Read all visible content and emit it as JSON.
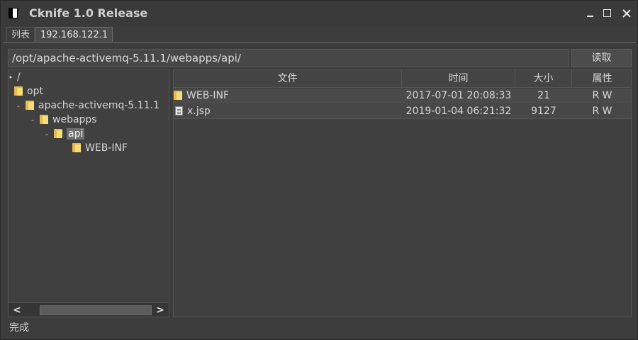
{
  "window": {
    "title": "Cknife 1.0 Release"
  },
  "tabs": [
    {
      "label": "列表"
    },
    {
      "label": "192.168.122.1"
    }
  ],
  "pathbar": {
    "value": "/opt/apache-activemq-5.11.1/webapps/api/",
    "read_label": "读取"
  },
  "tree": {
    "root": "/",
    "nodes": [
      {
        "label": "opt",
        "toggle": ""
      },
      {
        "label": "apache-activemq-5.11.1",
        "toggle": "-"
      },
      {
        "label": "webapps",
        "toggle": "-"
      },
      {
        "label": "api",
        "toggle": "-",
        "selected": true
      },
      {
        "label": "WEB-INF",
        "toggle": ""
      }
    ]
  },
  "table": {
    "headers": [
      "文件",
      "时间",
      "大小",
      "属性"
    ],
    "rows": [
      {
        "icon": "folder-icon",
        "name": "WEB-INF",
        "time": "2017-07-01 20:08:33",
        "size": "21",
        "attr": "R W"
      },
      {
        "icon": "file-icon",
        "name": "x.jsp",
        "time": "2019-01-04 06:21:32",
        "size": "9127",
        "attr": "R W"
      }
    ]
  },
  "status": {
    "text": "完成"
  }
}
